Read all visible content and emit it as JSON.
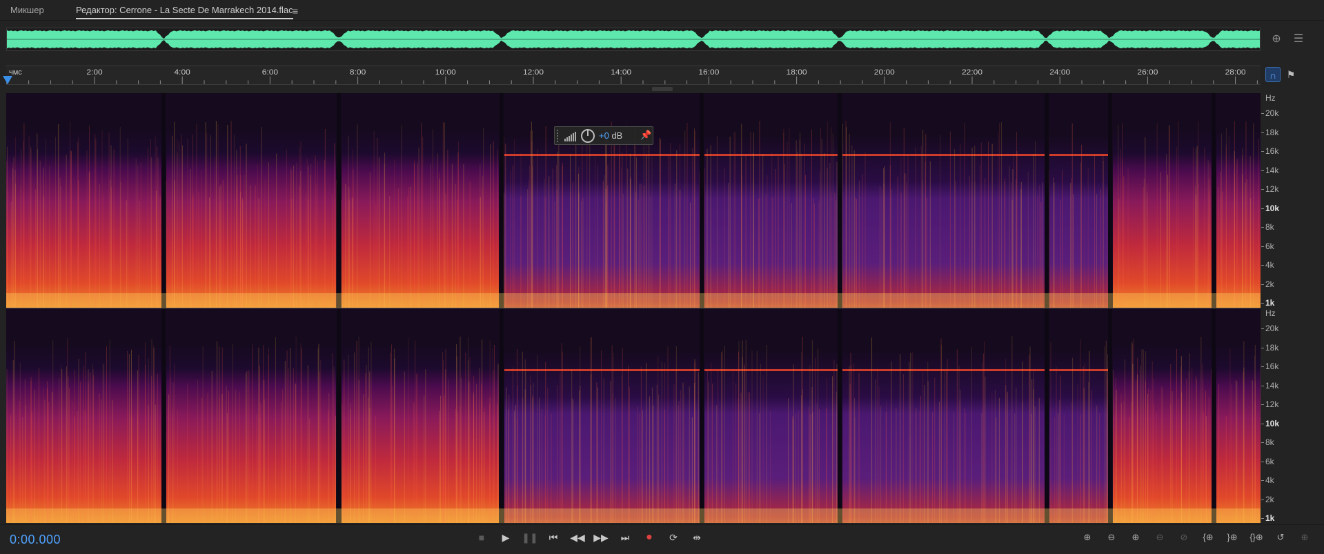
{
  "tabs": {
    "mixer": "Микшер",
    "editor": "Редактор: Cerrone - La Secte De Marrakech 2014.flac",
    "menu_icon": "hamburger-icon"
  },
  "ruler": {
    "unit": "чмс",
    "labels": [
      "2:00",
      "4:00",
      "6:00",
      "8:00",
      "10:00",
      "12:00",
      "14:00",
      "16:00",
      "18:00",
      "20:00",
      "22:00",
      "24:00",
      "26:00",
      "28:00"
    ]
  },
  "freq_axis": {
    "unit": "Hz",
    "labels": [
      "20k",
      "18k",
      "16k",
      "14k",
      "12k",
      "10k",
      "8k",
      "6k",
      "4k",
      "2k",
      "1k"
    ],
    "bold_labels": [
      "10k",
      "1k"
    ]
  },
  "hud": {
    "value": "+0",
    "unit": "dB"
  },
  "transport": {
    "timecode": "0:00.000"
  },
  "colors": {
    "accent": "#4fa3ff",
    "waveform": "#5ee8ad",
    "record": "#e04040"
  }
}
